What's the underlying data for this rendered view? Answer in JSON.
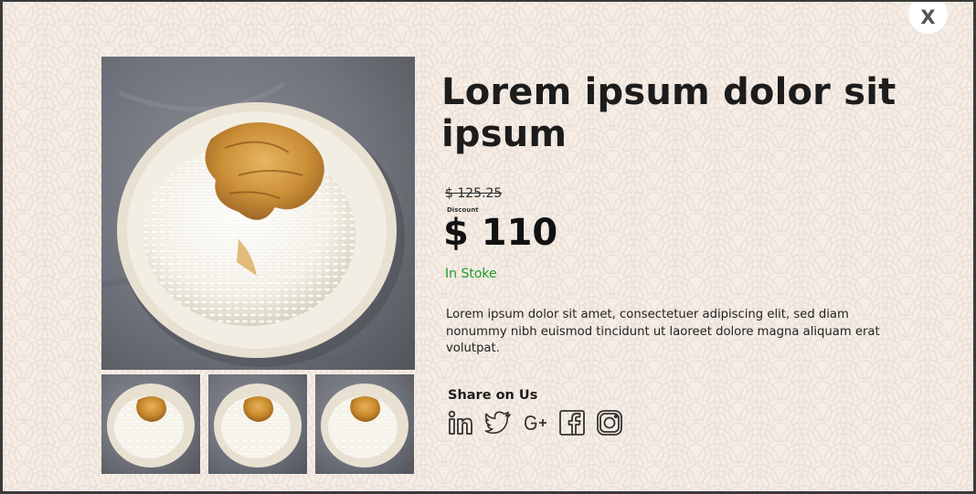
{
  "modal": {
    "close_label": "X"
  },
  "product": {
    "title": "Lorem ipsum dolor sit ipsum",
    "old_price": "$ 125.25",
    "discount_label": "Discount",
    "price": "$ 110",
    "stock_status": "In Stoke",
    "description": "Lorem ipsum dolor sit amet, consectetuer adipiscing elit, sed diam nonummy nibh euismod tincidunt ut laoreet dolore magna aliquam erat volutpat."
  },
  "gallery": {
    "main_image": "rice-bowl-photo",
    "thumbnails": [
      "rice-bowl-photo",
      "rice-bowl-photo",
      "rice-bowl-photo"
    ]
  },
  "share": {
    "label": "Share on Us",
    "icons": [
      "linkedin-icon",
      "twitter-icon",
      "google-plus-icon",
      "facebook-icon",
      "instagram-icon"
    ]
  },
  "colors": {
    "background": "#f5ede6",
    "pattern": "#ece2d9",
    "stock": "#1f9c2a",
    "text": "#1c1c1c"
  }
}
